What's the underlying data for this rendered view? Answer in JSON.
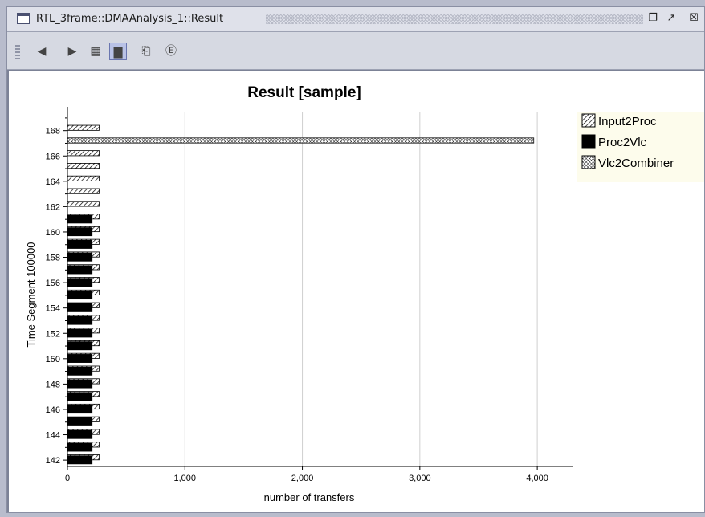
{
  "window": {
    "title": "RTL_3frame::DMAAnalysis_1::Result",
    "buttons": [
      {
        "name": "minimize-icon",
        "glyph": "❐"
      },
      {
        "name": "maximize-icon",
        "glyph": "↗"
      },
      {
        "name": "close-icon",
        "glyph": "☒"
      }
    ]
  },
  "toolbar": {
    "items": [
      {
        "name": "back-arrow-icon",
        "glyph": "◀",
        "active": false
      },
      {
        "name": "forward-arrow-icon",
        "glyph": "▶",
        "active": false
      },
      {
        "name": "table-view-icon",
        "glyph": "▦",
        "active": false
      },
      {
        "name": "chart-view-icon",
        "glyph": "▇",
        "active": true
      },
      {
        "name": "export-icon",
        "glyph": "⎗",
        "active": false
      },
      {
        "name": "help-icon",
        "glyph": "Ⓔ",
        "active": false
      }
    ]
  },
  "chart_data": {
    "type": "bar",
    "orientation": "horizontal",
    "title": "Result [sample]",
    "xlabel": "number of transfers",
    "ylabel": "Time Segment 100000",
    "xlim": [
      0,
      4300
    ],
    "ylim": [
      141.5,
      169.5
    ],
    "xticks": [
      {
        "value": 0,
        "label": "0"
      },
      {
        "value": 1000,
        "label": "1,000"
      },
      {
        "value": 2000,
        "label": "2,000"
      },
      {
        "value": 3000,
        "label": "3,000"
      },
      {
        "value": 4000,
        "label": "4,000"
      }
    ],
    "yticks": [
      142,
      144,
      146,
      148,
      150,
      152,
      154,
      156,
      158,
      160,
      162,
      164,
      166,
      168
    ],
    "grid": "vertical",
    "legend_position": "right",
    "series": [
      {
        "name": "Input2Proc",
        "pattern": "diagonal",
        "color": "#000000",
        "segments": [
          142,
          143,
          144,
          145,
          146,
          147,
          148,
          149,
          150,
          151,
          152,
          153,
          154,
          155,
          156,
          157,
          158,
          159,
          160,
          161,
          162,
          163,
          164,
          165,
          166,
          167,
          168
        ],
        "values": [
          270,
          270,
          270,
          270,
          270,
          270,
          270,
          270,
          270,
          270,
          270,
          270,
          270,
          270,
          270,
          270,
          270,
          270,
          270,
          270,
          270,
          270,
          270,
          270,
          270,
          270,
          270
        ]
      },
      {
        "name": "Proc2Vlc",
        "pattern": "solid",
        "color": "#000000",
        "segments": [
          142,
          143,
          144,
          145,
          146,
          147,
          148,
          149,
          150,
          151,
          152,
          153,
          154,
          155,
          156,
          157,
          158,
          159,
          160,
          161
        ],
        "values": [
          210,
          210,
          210,
          210,
          210,
          210,
          210,
          210,
          210,
          210,
          210,
          210,
          210,
          210,
          210,
          210,
          210,
          210,
          210,
          210
        ]
      },
      {
        "name": "Vlc2Combiner",
        "pattern": "crosshatch",
        "color": "#000000",
        "segments": [
          167
        ],
        "values": [
          3970
        ]
      }
    ]
  }
}
